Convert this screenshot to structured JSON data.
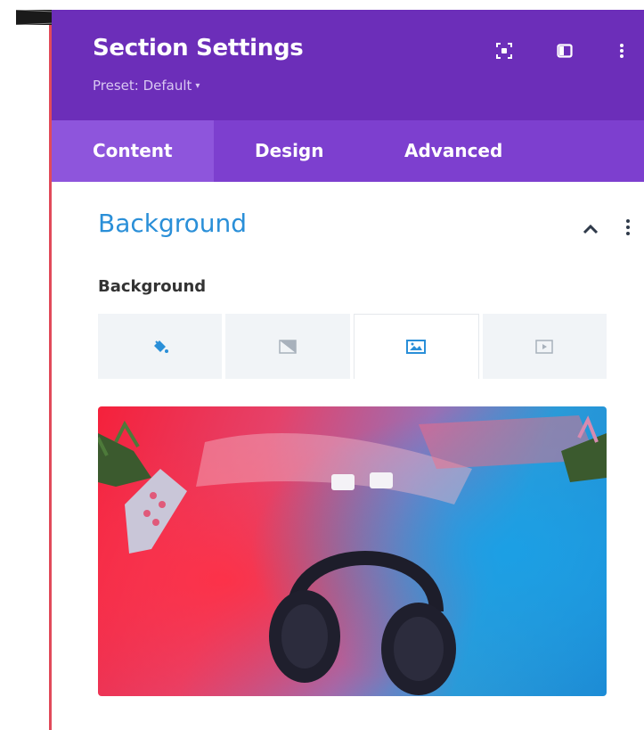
{
  "panel": {
    "title": "Section Settings",
    "preset_label": "Preset: Default",
    "preset_caret": "▾",
    "header_icons": [
      "focus-mode-icon",
      "split-view-icon",
      "more-vertical-icon"
    ],
    "colors": {
      "header": "#6c2eb9",
      "tabs": "#7d3fcf",
      "active_tab": "#8e55dc",
      "accent": "#2a8fd8"
    }
  },
  "tabs": [
    {
      "label": "Content",
      "active": true
    },
    {
      "label": "Design",
      "active": false
    },
    {
      "label": "Advanced",
      "active": false
    }
  ],
  "background_section": {
    "title": "Background",
    "field_label": "Background",
    "type_tabs": [
      {
        "icon": "paint-bucket-icon",
        "selected": false
      },
      {
        "icon": "gradient-icon",
        "selected": false
      },
      {
        "icon": "image-icon",
        "selected": true
      },
      {
        "icon": "video-icon",
        "selected": false
      }
    ],
    "image_preview": "headphones-photo"
  }
}
